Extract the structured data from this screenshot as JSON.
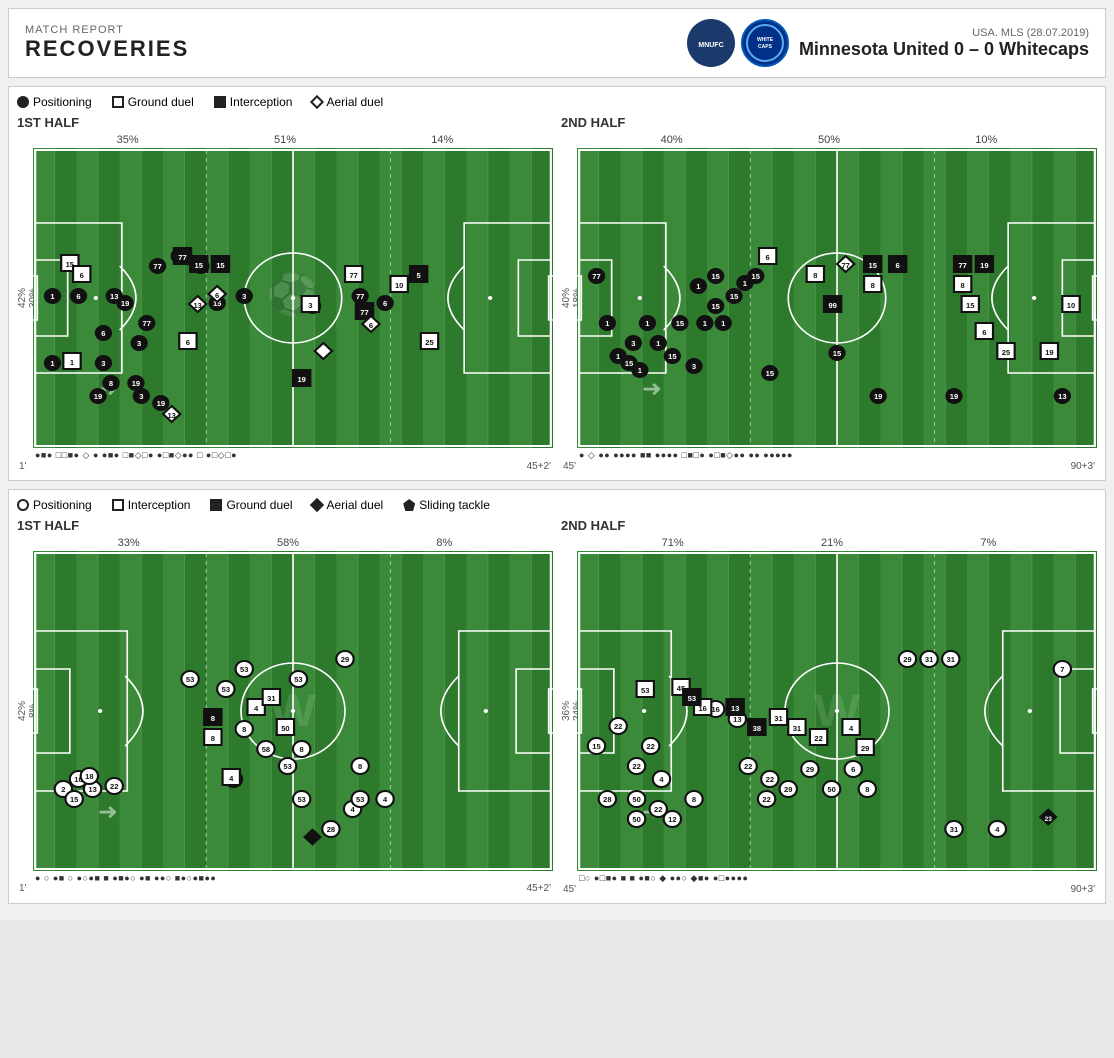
{
  "header": {
    "report_type": "MATCH REPORT",
    "title": "RECOVERIES",
    "league": "USA. MLS (28.07.2019)",
    "score": "Minnesota United 0 – 0 Whitecaps"
  },
  "team1_legend": {
    "items": [
      {
        "type": "circle-filled",
        "label": "Positioning"
      },
      {
        "type": "square",
        "label": "Ground duel"
      },
      {
        "type": "square-filled",
        "label": "Interception"
      },
      {
        "type": "diamond",
        "label": "Aerial duel"
      }
    ]
  },
  "team2_legend": {
    "items": [
      {
        "type": "circle-outline",
        "label": "Positioning"
      },
      {
        "type": "square",
        "label": "Interception"
      },
      {
        "type": "square-filled",
        "label": "Ground duel"
      },
      {
        "type": "diamond-filled",
        "label": "Aerial duel"
      },
      {
        "type": "pentagon",
        "label": "Sliding tackle"
      }
    ]
  },
  "team1_1st": {
    "title": "1ST HALF",
    "pct_left": "35%",
    "pct_mid": "51%",
    "pct_right": "14%",
    "side_top": "42%",
    "side_bottom": "30%",
    "time_start": "1'",
    "time_end": "45+2'"
  },
  "team1_2nd": {
    "title": "2ND HALF",
    "pct_left": "40%",
    "pct_mid": "50%",
    "pct_right": "10%",
    "side_top": "40%",
    "side_bottom": "18%",
    "time_start": "45'",
    "time_end": "90+3'"
  },
  "team2_1st": {
    "title": "1ST HALF",
    "pct_left": "33%",
    "pct_mid": "58%",
    "pct_right": "8%",
    "side_top": "42%",
    "side_bottom": "8%",
    "time_start": "1'",
    "time_end": "45+2'"
  },
  "team2_2nd": {
    "title": "2ND HALF",
    "pct_left": "71%",
    "pct_mid": "21%",
    "pct_right": "7%",
    "side_top": "36%",
    "side_bottom": "24%",
    "time_start": "45'",
    "time_end": "90+3'"
  }
}
